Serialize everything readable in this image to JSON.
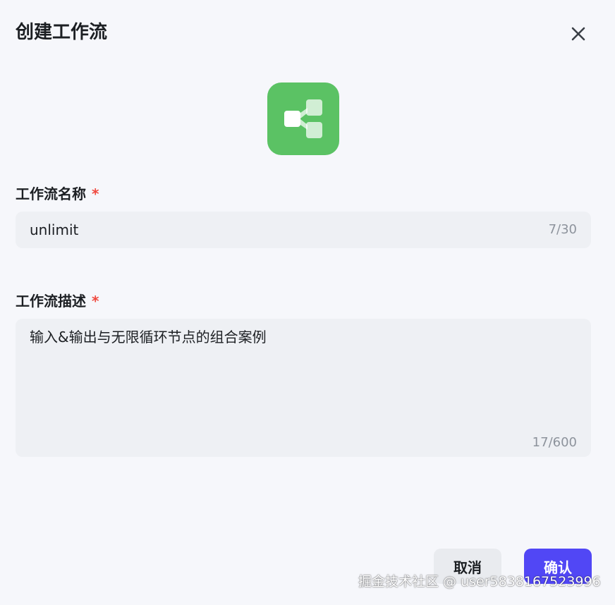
{
  "dialog": {
    "title": "创建工作流",
    "close_icon": "close-icon",
    "workflow_icon": "workflow-share-icon",
    "icon_color": "#5bc264"
  },
  "name_field": {
    "label": "工作流名称",
    "required_mark": "*",
    "value": "unlimit",
    "counter": "7/30"
  },
  "desc_field": {
    "label": "工作流描述",
    "required_mark": "*",
    "value": "输入&输出与无限循环节点的组合案例",
    "counter": "17/600"
  },
  "actions": {
    "cancel_label": "取消",
    "confirm_label": "确认",
    "confirm_color": "#5147f5"
  },
  "watermark": "掘金技术社区 @ user5838167523996"
}
